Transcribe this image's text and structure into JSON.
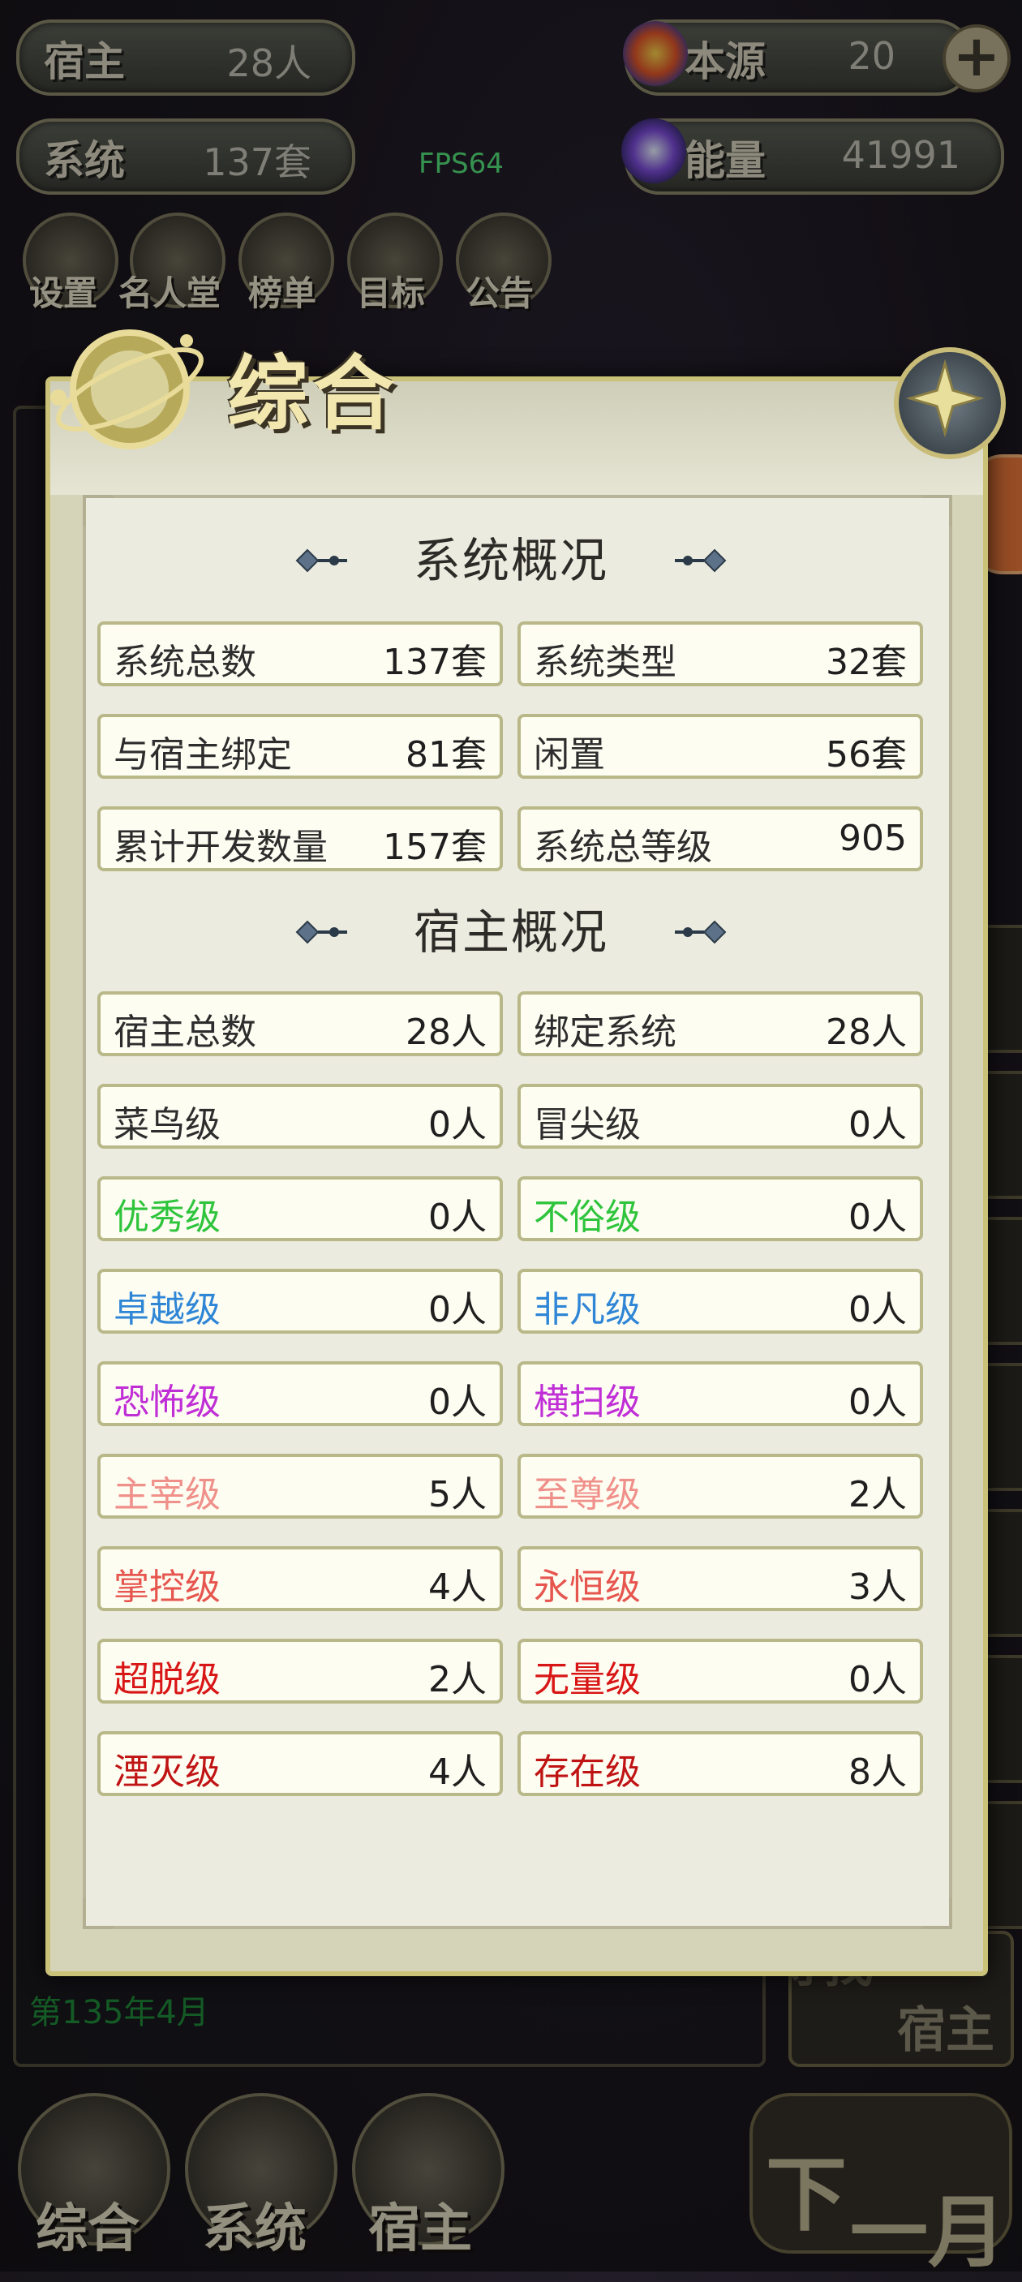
{
  "top_stats": {
    "hosts_label": "宿主",
    "hosts_value": "28人",
    "systems_label": "系统",
    "systems_value": "137套",
    "source_label": "本源",
    "source_value": "20",
    "energy_label": "能量",
    "energy_value": "41991",
    "plus_symbol": "+"
  },
  "fps": "FPS64",
  "top_menu": [
    {
      "label": "设置",
      "icon": "gear-icon"
    },
    {
      "label": "名人堂",
      "icon": "helmet-icon"
    },
    {
      "label": "榜单",
      "icon": "rank-icon"
    },
    {
      "label": "目标",
      "icon": "scroll-icon"
    },
    {
      "label": "公告",
      "icon": "bell-icon"
    }
  ],
  "background": {
    "date": "第135年4月",
    "find_host_line1": "寻找",
    "find_host_line2": "宿主"
  },
  "bottom_nav": [
    {
      "label": "综合",
      "icon": "rock-icon"
    },
    {
      "label": "系统",
      "icon": "yin-yang-icon"
    },
    {
      "label": "宿主",
      "icon": "character-icon"
    }
  ],
  "next_month_btn": {
    "c1": "下",
    "c2": "一月"
  },
  "modal": {
    "title": "综合",
    "section1": {
      "title": "系统概况",
      "rows": [
        [
          {
            "k": "系统总数",
            "v": "137套"
          },
          {
            "k": "系统类型",
            "v": "32套"
          }
        ],
        [
          {
            "k": "与宿主绑定",
            "v": "81套"
          },
          {
            "k": "闲置",
            "v": "56套"
          }
        ],
        [
          {
            "k": "累计开发数量",
            "v": "157套"
          },
          {
            "k": "系统总等级",
            "v": "905"
          }
        ]
      ]
    },
    "section2": {
      "title": "宿主概况",
      "rows": [
        [
          {
            "k": "宿主总数",
            "v": "28人",
            "color": "#2d2d2d"
          },
          {
            "k": "绑定系统",
            "v": "28人",
            "color": "#2d2d2d"
          }
        ],
        [
          {
            "k": "菜鸟级",
            "v": "0人",
            "color": "#2d2d2d"
          },
          {
            "k": "冒尖级",
            "v": "0人",
            "color": "#2d2d2d"
          }
        ],
        [
          {
            "k": "优秀级",
            "v": "0人",
            "color": "#2ec43c"
          },
          {
            "k": "不俗级",
            "v": "0人",
            "color": "#2ec43c"
          }
        ],
        [
          {
            "k": "卓越级",
            "v": "0人",
            "color": "#2f86d6"
          },
          {
            "k": "非凡级",
            "v": "0人",
            "color": "#2f86d6"
          }
        ],
        [
          {
            "k": "恐怖级",
            "v": "0人",
            "color": "#c02ed6"
          },
          {
            "k": "横扫级",
            "v": "0人",
            "color": "#c02ed6"
          }
        ],
        [
          {
            "k": "主宰级",
            "v": "5人",
            "color": "#f0908a"
          },
          {
            "k": "至尊级",
            "v": "2人",
            "color": "#f0908a"
          }
        ],
        [
          {
            "k": "掌控级",
            "v": "4人",
            "color": "#e6554e"
          },
          {
            "k": "永恒级",
            "v": "3人",
            "color": "#e6554e"
          }
        ],
        [
          {
            "k": "超脱级",
            "v": "2人",
            "color": "#d91616"
          },
          {
            "k": "无量级",
            "v": "0人",
            "color": "#d91616"
          }
        ],
        [
          {
            "k": "湮灭级",
            "v": "4人",
            "color": "#c01414"
          },
          {
            "k": "存在级",
            "v": "8人",
            "color": "#c01414"
          }
        ]
      ]
    }
  }
}
